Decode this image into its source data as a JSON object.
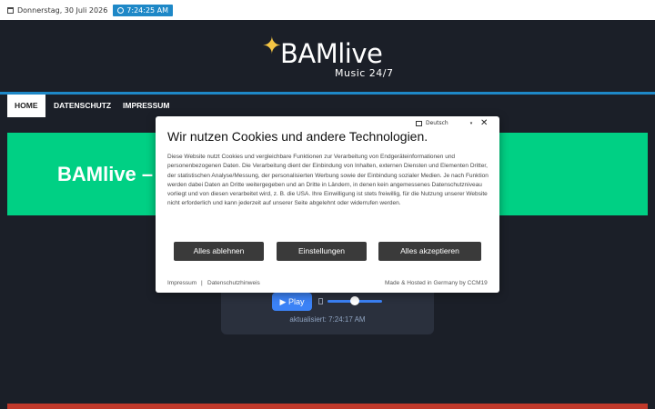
{
  "topbar": {
    "date": "Donnerstag, 30 Juli 2026",
    "time": "7:24:25 AM",
    "calendar_icon": "calendar-icon",
    "clock_icon": "clock-icon"
  },
  "brand": {
    "name": "BAMlive",
    "tagline": "Music 24/7",
    "star_color": "#f5c544"
  },
  "nav": {
    "items": [
      {
        "label": "HOME",
        "active": true
      },
      {
        "label": "DATENSCHUTZ",
        "active": false
      },
      {
        "label": "IMPRESSUM",
        "active": false
      }
    ]
  },
  "banner": {
    "title": "BAMlive –",
    "color": "#00d084"
  },
  "player": {
    "play_label": "▶ Play",
    "updated": "aktualisiert: 7:24:17 AM",
    "volume_icon": "volume-icon"
  },
  "cookie_modal": {
    "language": "Deutsch",
    "title": "Wir nutzen Cookies und andere Technologien.",
    "text": "Diese Website nutzt Cookies und vergleichbare Funktionen zur Verarbeitung von Endgeräteinformationen und personenbezogenen Daten. Die Verarbeitung dient der Einbindung von Inhalten, externen Diensten und Elementen Dritter, der statistischen Analyse/Messung, der personalisierten Werbung sowie der Einbindung sozialer Medien. Je nach Funktion werden dabei Daten an Dritte weitergegeben und an Dritte in Ländern, in denen kein angemessenes Datenschutzniveau vorliegt und von diesen verarbeitet wird, z. B. die USA. Ihre Einwilligung ist stets freiwillig, für die Nutzung unserer Website nicht erforderlich und kann jederzeit auf unserer Seite abgelehnt oder widerrufen werden.",
    "buttons": {
      "reject": "Alles ablehnen",
      "settings": "Einstellungen",
      "accept": "Alles akzeptieren"
    },
    "footer": {
      "impressum": "Impressum",
      "separator": "|",
      "privacy": "Datenschutzhinweis",
      "hosted": "Made & Hosted in Germany by CCM19"
    }
  }
}
